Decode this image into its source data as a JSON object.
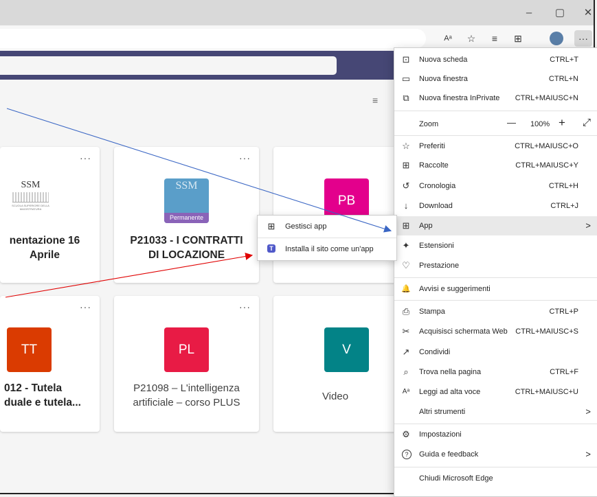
{
  "window": {
    "minimize": "–",
    "restore": "▢",
    "close": "✕"
  },
  "toolbar": {
    "read_aloud": "Aᵃ",
    "favorite": "☆",
    "favorites": "≡",
    "collections": "⊞",
    "more": "···"
  },
  "cards": [
    {
      "title_line1": "nentazione 16",
      "title_line2": "Aprile",
      "logo": "SSM",
      "logo_caption": "SCUOLA SUPERIORE DELLA MAGISTRATURA",
      "dots": "···"
    },
    {
      "title_line1": "P21033 - I CONTRATTI",
      "title_line2": "DI LOCAZIONE",
      "logo": "SSM",
      "badge": "Permanente",
      "dots": "···"
    },
    {
      "tile": "PB",
      "tile_color": "#e3008c"
    },
    {
      "title_line1": "012 - Tutela",
      "title_line2": "duale e tutela...",
      "tile": "TT",
      "tile_color": "#da3b01",
      "dots": "···"
    },
    {
      "title_line1": "P21098 – L'intelligenza",
      "title_line2": "artificiale – corso PLUS",
      "tile": "PL",
      "tile_color": "#e81b45",
      "dots": "···"
    },
    {
      "title_line1": "Video",
      "tile": "V",
      "tile_color": "#038387"
    }
  ],
  "menu": {
    "items": [
      {
        "label": "Nuova scheda",
        "shortcut": "CTRL+T",
        "icon": "new-tab-icon",
        "glyph": "⊡"
      },
      {
        "label": "Nuova finestra",
        "shortcut": "CTRL+N",
        "icon": "new-window-icon",
        "glyph": "▭"
      },
      {
        "label": "Nuova finestra InPrivate",
        "shortcut": "CTRL+MAIUSC+N",
        "icon": "inprivate-icon",
        "glyph": "⧉"
      },
      {
        "label": "Zoom",
        "zoom_minus": "—",
        "zoom_value": "100%",
        "zoom_plus": "+",
        "fullscreen": "⤢"
      },
      {
        "label": "Preferiti",
        "shortcut": "CTRL+MAIUSC+O",
        "icon": "favorites-icon",
        "glyph": "☆"
      },
      {
        "label": "Raccolte",
        "shortcut": "CTRL+MAIUSC+Y",
        "icon": "collections-icon",
        "glyph": "⊞"
      },
      {
        "label": "Cronologia",
        "shortcut": "CTRL+H",
        "icon": "history-icon",
        "glyph": "↺"
      },
      {
        "label": "Download",
        "shortcut": "CTRL+J",
        "icon": "download-icon",
        "glyph": "↓"
      },
      {
        "label": "App",
        "arrow": ">",
        "icon": "apps-icon",
        "glyph": "⊞"
      },
      {
        "label": "Estensioni",
        "icon": "extensions-icon",
        "glyph": "✦"
      },
      {
        "label": "Prestazione",
        "icon": "performance-icon",
        "glyph": "♡"
      },
      {
        "label": "Avvisi e suggerimenti",
        "icon": "alerts-icon",
        "glyph": "🔔"
      },
      {
        "label": "Stampa",
        "shortcut": "CTRL+P",
        "icon": "print-icon",
        "glyph": "⎙"
      },
      {
        "label": "Acquisisci schermata Web",
        "shortcut": "CTRL+MAIUSC+S",
        "icon": "screenshot-icon",
        "glyph": "✂"
      },
      {
        "label": "Condividi",
        "icon": "share-icon",
        "glyph": "↗"
      },
      {
        "label": "Trova nella pagina",
        "shortcut": "CTRL+F",
        "icon": "find-icon",
        "glyph": "⌕"
      },
      {
        "label": "Leggi ad alta voce",
        "shortcut": "CTRL+MAIUSC+U",
        "icon": "read-aloud-icon",
        "glyph": "Aᵃ"
      },
      {
        "label": "Altri strumenti",
        "arrow": ">"
      },
      {
        "label": "Impostazioni",
        "icon": "settings-icon",
        "glyph": "⚙"
      },
      {
        "label": "Guida e feedback",
        "arrow": ">",
        "icon": "help-icon",
        "glyph": "?"
      },
      {
        "label": "Chiudi Microsoft Edge"
      }
    ]
  },
  "submenu": {
    "items": [
      {
        "label": "Gestisci app",
        "icon": "manage-apps-icon",
        "glyph": "⊞"
      },
      {
        "label": "Installa il sito come un'app",
        "icon": "teams-icon",
        "glyph": "T"
      }
    ]
  },
  "colors": {
    "teams_bar": "#464775",
    "arrow_blue": "#1f5fbf",
    "arrow_red": "#e00000"
  }
}
